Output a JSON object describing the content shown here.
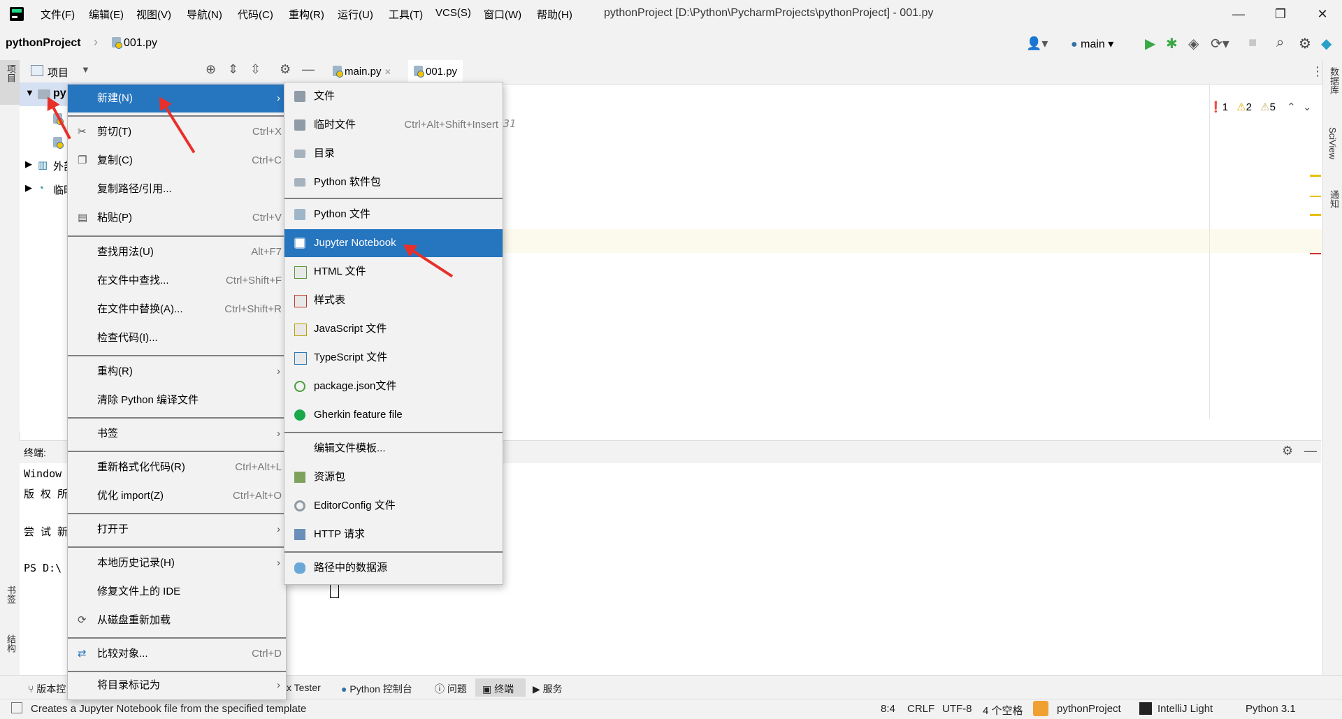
{
  "titlebar": {
    "menus": [
      "文件(F)",
      "编辑(E)",
      "视图(V)",
      "导航(N)",
      "代码(C)",
      "重构(R)",
      "运行(U)",
      "工具(T)",
      "VCS(S)",
      "窗口(W)",
      "帮助(H)"
    ],
    "window_title": "pythonProject [D:\\Python\\PycharmProjects\\pythonProject] - 001.py",
    "minimize": "—",
    "restore": "❐",
    "close": "✕"
  },
  "navbar": {
    "project": "pythonProject",
    "separator": "›",
    "file": "001.py",
    "branch": "main"
  },
  "left_strip": {
    "project_label": "项目",
    "bookmarks_label": "书签",
    "structure_label": "结构"
  },
  "right_strip": {
    "database_label": "数据库",
    "sciview_label": "SciView",
    "notifications_label": "通知"
  },
  "project_panel": {
    "title": "项目",
    "tree": [
      "py",
      "外部",
      "临时"
    ]
  },
  "editor": {
    "tabs": [
      "main.py",
      "001.py"
    ],
    "comment_fragment": "31",
    "inspections": {
      "errors": "1",
      "warnings": "2",
      "weak_warnings": "5"
    }
  },
  "terminal": {
    "label": "终端:",
    "lines": [
      "Window",
      "版 权 所",
      "",
      "尝 试 新",
      "",
      "PS D:\\"
    ]
  },
  "context_menu": {
    "items": [
      {
        "label": "新建(N)",
        "shortcut": "",
        "submenu": true,
        "selected": true
      },
      {
        "label": "剪切(T)",
        "shortcut": "Ctrl+X"
      },
      {
        "label": "复制(C)",
        "shortcut": "Ctrl+C"
      },
      {
        "label": "复制路径/引用...",
        "shortcut": ""
      },
      {
        "label": "粘贴(P)",
        "shortcut": "Ctrl+V"
      },
      {
        "label": "查找用法(U)",
        "shortcut": "Alt+F7"
      },
      {
        "label": "在文件中查找...",
        "shortcut": "Ctrl+Shift+F"
      },
      {
        "label": "在文件中替换(A)...",
        "shortcut": "Ctrl+Shift+R"
      },
      {
        "label": "检查代码(I)...",
        "shortcut": ""
      },
      {
        "label": "重构(R)",
        "shortcut": "",
        "submenu": true
      },
      {
        "label": "清除 Python 编译文件",
        "shortcut": ""
      },
      {
        "label": "书签",
        "shortcut": "",
        "submenu": true
      },
      {
        "label": "重新格式化代码(R)",
        "shortcut": "Ctrl+Alt+L"
      },
      {
        "label": "优化 import(Z)",
        "shortcut": "Ctrl+Alt+O"
      },
      {
        "label": "打开于",
        "shortcut": "",
        "submenu": true
      },
      {
        "label": "本地历史记录(H)",
        "shortcut": "",
        "submenu": true
      },
      {
        "label": "修复文件上的 IDE",
        "shortcut": ""
      },
      {
        "label": "从磁盘重新加载",
        "shortcut": ""
      },
      {
        "label": "比较对象...",
        "shortcut": "Ctrl+D"
      },
      {
        "label": "将目录标记为",
        "shortcut": "",
        "submenu": true
      }
    ],
    "arrow": "›"
  },
  "new_submenu": {
    "items": [
      {
        "label": "文件",
        "icon": "file-icon"
      },
      {
        "label": "临时文件",
        "shortcut": "Ctrl+Alt+Shift+Insert",
        "icon": "scratch-file-icon"
      },
      {
        "label": "目录",
        "icon": "folder-icon"
      },
      {
        "label": "Python 软件包",
        "icon": "package-icon"
      },
      {
        "label": "Python 文件",
        "icon": "python-file-icon"
      },
      {
        "label": "Jupyter Notebook",
        "icon": "jupyter-icon",
        "selected": true
      },
      {
        "label": "HTML 文件",
        "icon": "html-icon"
      },
      {
        "label": "样式表",
        "icon": "css-icon"
      },
      {
        "label": "JavaScript 文件",
        "icon": "js-icon"
      },
      {
        "label": "TypeScript 文件",
        "icon": "ts-icon"
      },
      {
        "label": "package.json文件",
        "icon": "json-icon"
      },
      {
        "label": "Gherkin feature file",
        "icon": "gherkin-icon"
      },
      {
        "label": "编辑文件模板...",
        "icon": ""
      },
      {
        "label": "资源包",
        "icon": "bundle-icon"
      },
      {
        "label": "EditorConfig 文件",
        "icon": "gear-icon"
      },
      {
        "label": "HTTP 请求",
        "icon": "api-icon"
      },
      {
        "label": "路径中的数据源",
        "icon": "database-icon"
      }
    ]
  },
  "bottom_tools": [
    "版本控",
    "x Tester",
    "Python 控制台",
    "问题",
    "终端",
    "服务"
  ],
  "statusbar": {
    "message": "Creates a Jupyter Notebook file from the specified template",
    "position": "8:4",
    "line_sep": "CRLF",
    "encoding": "UTF-8",
    "indent": "4 个空格",
    "project": "pythonProject",
    "theme": "IntelliJ Light",
    "interpreter": "Python 3.1"
  },
  "colors": {
    "accent": "#2675bf",
    "annotation_arrow": "#e8302a"
  }
}
